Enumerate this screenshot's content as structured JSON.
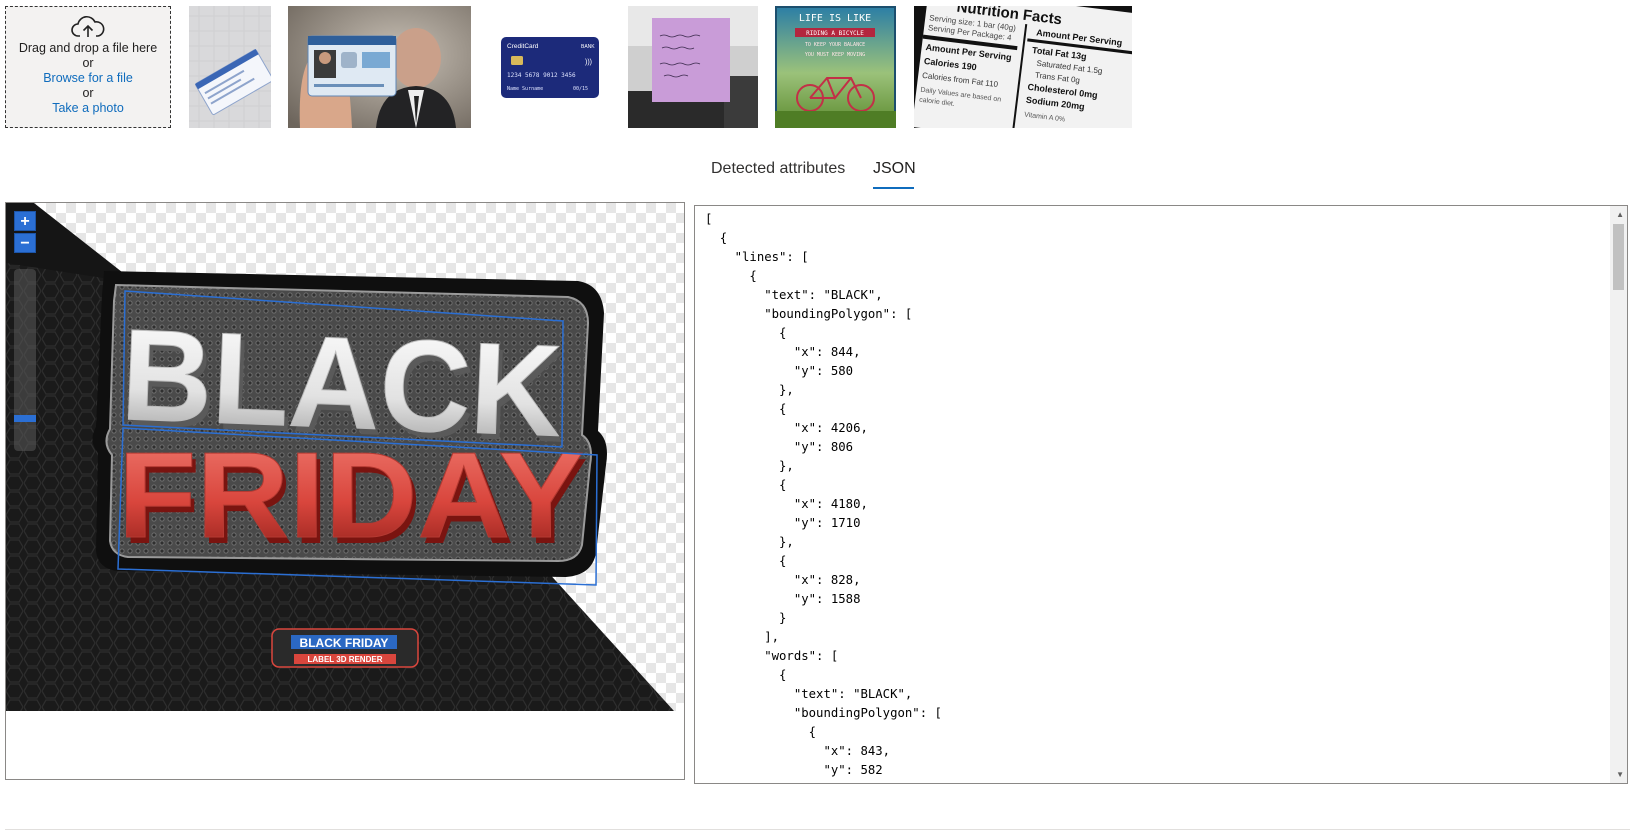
{
  "upload": {
    "icon": "cloud-upload-icon",
    "drag_text": "Drag and drop a file here",
    "or_1": "or",
    "browse_label": "Browse for a file",
    "or_2": "or",
    "photo_label": "Take a photo"
  },
  "samples": {
    "credit_card": {
      "brand": "CreditCard",
      "bank": "BANK",
      "number": "1234 5678 9012 3456",
      "name": "Name Surname",
      "expiry": "00/15"
    },
    "bike_poster": {
      "line1": "LIFE IS LIKE",
      "line2": "RIDING A BICYCLE",
      "line3": "TO KEEP YOUR BALANCE",
      "line4": "YOU MUST KEEP MOVING"
    },
    "nutrition": {
      "title": "Nutrition Facts",
      "serving": "Serving size: 1 bar (40g)",
      "per_package": "Serving Per Package: 4",
      "amount_left": "Amount Per Serving",
      "calories": "Calories 190",
      "from_fat": "Calories from Fat 110",
      "daily": "Daily Values are based on",
      "diet": "calorie diet.",
      "amount_right": "Amount Per Serving",
      "total_fat": "Total Fat 13g",
      "sat_fat": "Saturated Fat 1.5g",
      "trans_fat": "Trans Fat 0g",
      "cholesterol": "Cholesterol 0mg",
      "sodium": "Sodium 20mg",
      "vitamin": "Vitamin A 0%"
    }
  },
  "tabs": {
    "attributes_label": "Detected attributes",
    "json_label": "JSON",
    "active": "json"
  },
  "viewer": {
    "zoom_in": "+",
    "zoom_out": "−",
    "zoom_level": 0.18,
    "headline_line1": "BLACK",
    "headline_line2": "FRIDAY",
    "small_label_line1": "BLACK FRIDAY",
    "small_label_line2": "LABEL 3D RENDER",
    "accent_color": "#2b6fd4",
    "red_color": "#d9463d"
  },
  "json_lines": [
    "[",
    "  {",
    "    \"lines\": [",
    "      {",
    "        \"text\": \"BLACK\",",
    "        \"boundingPolygon\": [",
    "          {",
    "            \"x\": 844,",
    "            \"y\": 580",
    "          },",
    "          {",
    "            \"x\": 4206,",
    "            \"y\": 806",
    "          },",
    "          {",
    "            \"x\": 4180,",
    "            \"y\": 1710",
    "          },",
    "          {",
    "            \"x\": 828,",
    "            \"y\": 1588",
    "          }",
    "        ],",
    "        \"words\": [",
    "          {",
    "            \"text\": \"BLACK\",",
    "            \"boundingPolygon\": [",
    "              {",
    "                \"x\": 843,",
    "                \"y\": 582",
    "              },"
  ],
  "scroll": {
    "up": "▲",
    "down": "▼"
  }
}
